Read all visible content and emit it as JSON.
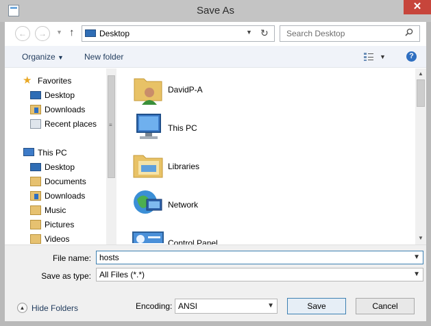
{
  "window": {
    "title": "Save As",
    "close_glyph": "✕"
  },
  "address": {
    "location": "Desktop",
    "search_placeholder": "Search Desktop"
  },
  "toolbar": {
    "organize": "Organize",
    "new_folder": "New folder"
  },
  "nav": {
    "groups": [
      {
        "label": "Favorites",
        "icon": "star-icon",
        "items": [
          {
            "label": "Desktop",
            "icon": "desktop-icon"
          },
          {
            "label": "Downloads",
            "icon": "downloads-icon"
          },
          {
            "label": "Recent places",
            "icon": "recent-places-icon"
          }
        ]
      },
      {
        "label": "This PC",
        "icon": "computer-icon",
        "items": [
          {
            "label": "Desktop",
            "icon": "desktop-icon"
          },
          {
            "label": "Documents",
            "icon": "documents-icon"
          },
          {
            "label": "Downloads",
            "icon": "downloads-icon"
          },
          {
            "label": "Music",
            "icon": "music-icon"
          },
          {
            "label": "Pictures",
            "icon": "pictures-icon"
          },
          {
            "label": "Videos",
            "icon": "videos-icon"
          }
        ]
      }
    ]
  },
  "content": {
    "items": [
      {
        "label": "DavidP-A",
        "icon": "user-folder-icon"
      },
      {
        "label": "This PC",
        "icon": "computer-icon"
      },
      {
        "label": "Libraries",
        "icon": "libraries-icon"
      },
      {
        "label": "Network",
        "icon": "network-icon"
      },
      {
        "label": "Control Panel",
        "icon": "control-panel-icon"
      }
    ]
  },
  "form": {
    "file_name_label": "File name:",
    "file_name_value": "hosts",
    "save_type_label": "Save as type:",
    "save_type_value": "All Files  (*.*)",
    "encoding_label": "Encoding:",
    "encoding_value": "ANSI",
    "hide_folders": "Hide Folders",
    "save": "Save",
    "cancel": "Cancel"
  },
  "colors": {
    "accent": "#1e395b",
    "close": "#c7453b",
    "toolbar_bg": "#f0f3f9"
  }
}
